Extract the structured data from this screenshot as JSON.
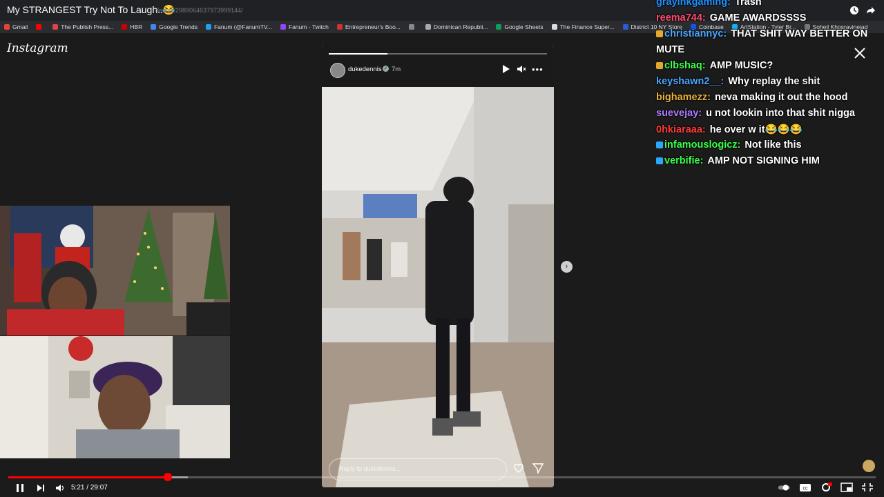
{
  "video": {
    "title": "My STRANGEST Try Not To Laugh..😂",
    "url_fragment": "dennis/2989064637973999144/"
  },
  "bookmarks": [
    {
      "label": "Gmail",
      "color": "#ea4335"
    },
    {
      "label": "",
      "color": "#ff0000"
    },
    {
      "label": "The Publish Press...",
      "color": "#d44"
    },
    {
      "label": "HBR",
      "color": "#c00"
    },
    {
      "label": "Google Trends",
      "color": "#4285f4"
    },
    {
      "label": "Fanum (@FanumTV...",
      "color": "#1da1f2"
    },
    {
      "label": "Fanum - Twitch",
      "color": "#9146ff"
    },
    {
      "label": "Entrepreneur's Boo...",
      "color": "#c33"
    },
    {
      "label": "",
      "color": "#888"
    },
    {
      "label": "Dominican Republi...",
      "color": "#aaa"
    },
    {
      "label": "Google Sheets",
      "color": "#0f9d58"
    },
    {
      "label": "The Finance Super...",
      "color": "#ddd"
    },
    {
      "label": "District 10 NY Store",
      "color": "#2a5bd7"
    },
    {
      "label": "Coinbase",
      "color": "#1652f0"
    },
    {
      "label": "ArtStation - Tyler Br...",
      "color": "#13aff0"
    },
    {
      "label": "Soheil Khosravinejad",
      "color": "#777"
    }
  ],
  "instagram": {
    "logo": "Instagram",
    "story": {
      "username": "dukedennis",
      "time": "7m",
      "reply_placeholder": "Reply to dukedennis...",
      "progress": 0.27
    }
  },
  "chat": [
    {
      "user": "grayinkgaming",
      "color": "#1e90ff",
      "text": "Trash",
      "badge": ""
    },
    {
      "user": "reema744",
      "color": "#ff4d6d",
      "text": "GAME AWARDSSSS",
      "badge": ""
    },
    {
      "user": "christiannyc",
      "color": "#4da6ff",
      "text": "THAT SHIT WAY BETTER ON",
      "badge": "#e4a82b"
    },
    {
      "user": "",
      "color": "#fff",
      "text": "MUTE",
      "badge": ""
    },
    {
      "user": "clbshaq",
      "color": "#3cff4a",
      "text": "AMP MUSIC?",
      "badge": "#e4a82b"
    },
    {
      "user": "keyshawn2__",
      "color": "#4da6ff",
      "text": "Why replay the shit",
      "badge": ""
    },
    {
      "user": "bighamezz",
      "color": "#e8b23a",
      "text": "neva making it out the hood",
      "badge": ""
    },
    {
      "user": "suevejay",
      "color": "#b07cff",
      "text": "u not lookin into that shit nigga",
      "badge": ""
    },
    {
      "user": "0hkiaraaa",
      "color": "#ff3a3a",
      "text": "he over w it😂😂😂",
      "badge": ""
    },
    {
      "user": "infamouslogicz",
      "color": "#3cff4a",
      "text": "Not like this",
      "badge": "#2aa7ff"
    },
    {
      "user": "verbifie",
      "color": "#3cff4a",
      "text": "AMP NOT SIGNING HIM",
      "badge": "#2aa7ff"
    }
  ],
  "player": {
    "time_label": "5:21 / 29:07",
    "played": 0.184,
    "buffered": 0.207,
    "accent": "#ff0000"
  },
  "icons": {
    "close": "close-icon",
    "next": "chevron-right-icon",
    "heart": "heart-icon",
    "send": "send-icon"
  }
}
